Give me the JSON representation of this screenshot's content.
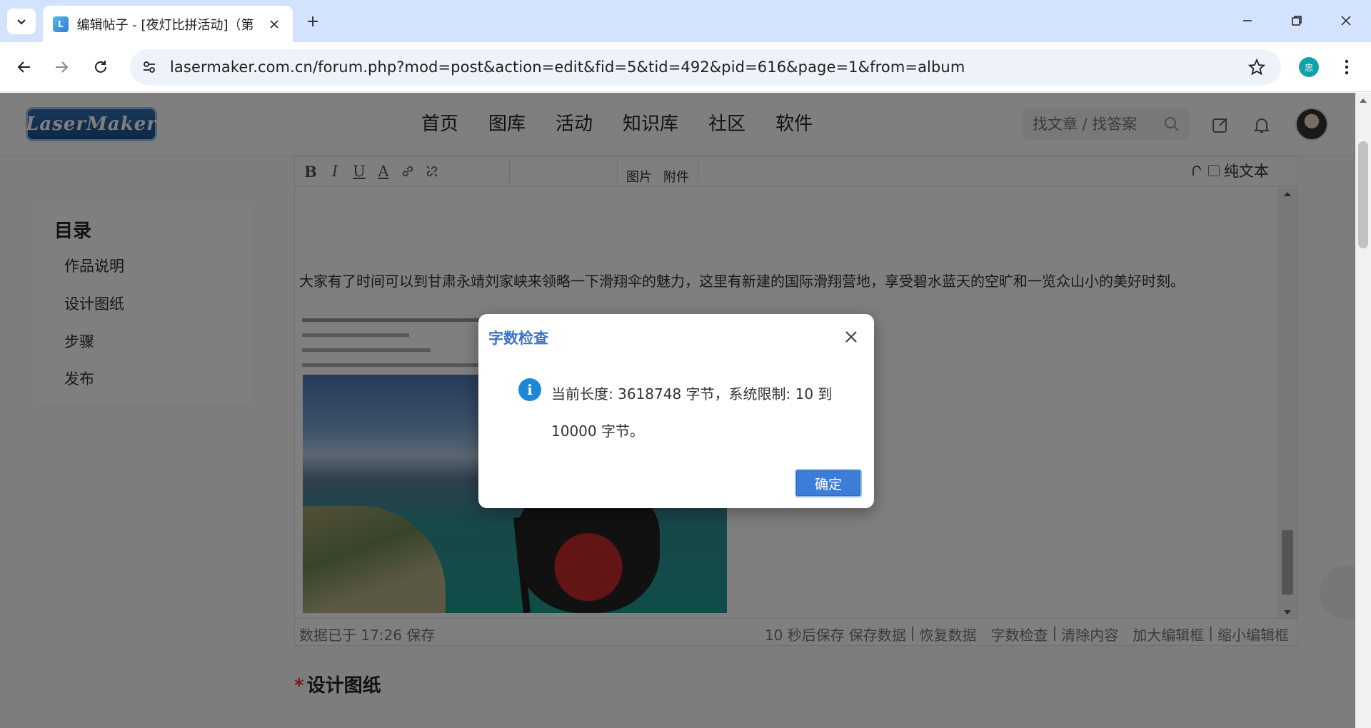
{
  "browser": {
    "tab_title": "编辑帖子 - [夜灯比拼活动]（第",
    "url": "lasermaker.com.cn/forum.php?mod=post&action=edit&fid=5&tid=492&pid=616&page=1&from=album",
    "profile_initial": "忠"
  },
  "site": {
    "logo_text": "LaserMaker",
    "nav": [
      "首页",
      "图库",
      "活动",
      "知识库",
      "社区",
      "软件"
    ],
    "search_placeholder": "找文章 / 找答案"
  },
  "toc": {
    "title": "目录",
    "items": [
      "作品说明",
      "设计图纸",
      "步骤",
      "发布"
    ]
  },
  "editor": {
    "toolbar": {
      "bold": "B",
      "italic": "I",
      "underline": "U",
      "color": "A",
      "image_label": "图片",
      "attachment_label": "附件",
      "plain_text_label": "纯文本"
    },
    "paragraph": "大家有了时间可以到甘肃永靖刘家峡来领略一下滑翔伞的魅力，这里有新建的国际滑翔营地，享受碧水蓝天的空旷和一览众山小的美好时刻。",
    "status": {
      "saved": "数据已于 17:26 保存",
      "autosave": "10 秒后保存",
      "save_data": "保存数据",
      "restore_data": "恢复数据",
      "word_check": "字数检查",
      "clear": "清除内容",
      "enlarge": "加大编辑框",
      "shrink": "缩小编辑框",
      "sep": "|"
    }
  },
  "section": {
    "required_mark": "*",
    "title": "设计图纸"
  },
  "dialog": {
    "title": "字数检查",
    "message": "当前长度: 3618748 字节，系统限制: 10 到 10000 字节。",
    "ok_label": "确定"
  },
  "colors": {
    "accent": "#3b74c9",
    "info": "#1c87d6",
    "tab_strip": "#d3e3fd"
  }
}
